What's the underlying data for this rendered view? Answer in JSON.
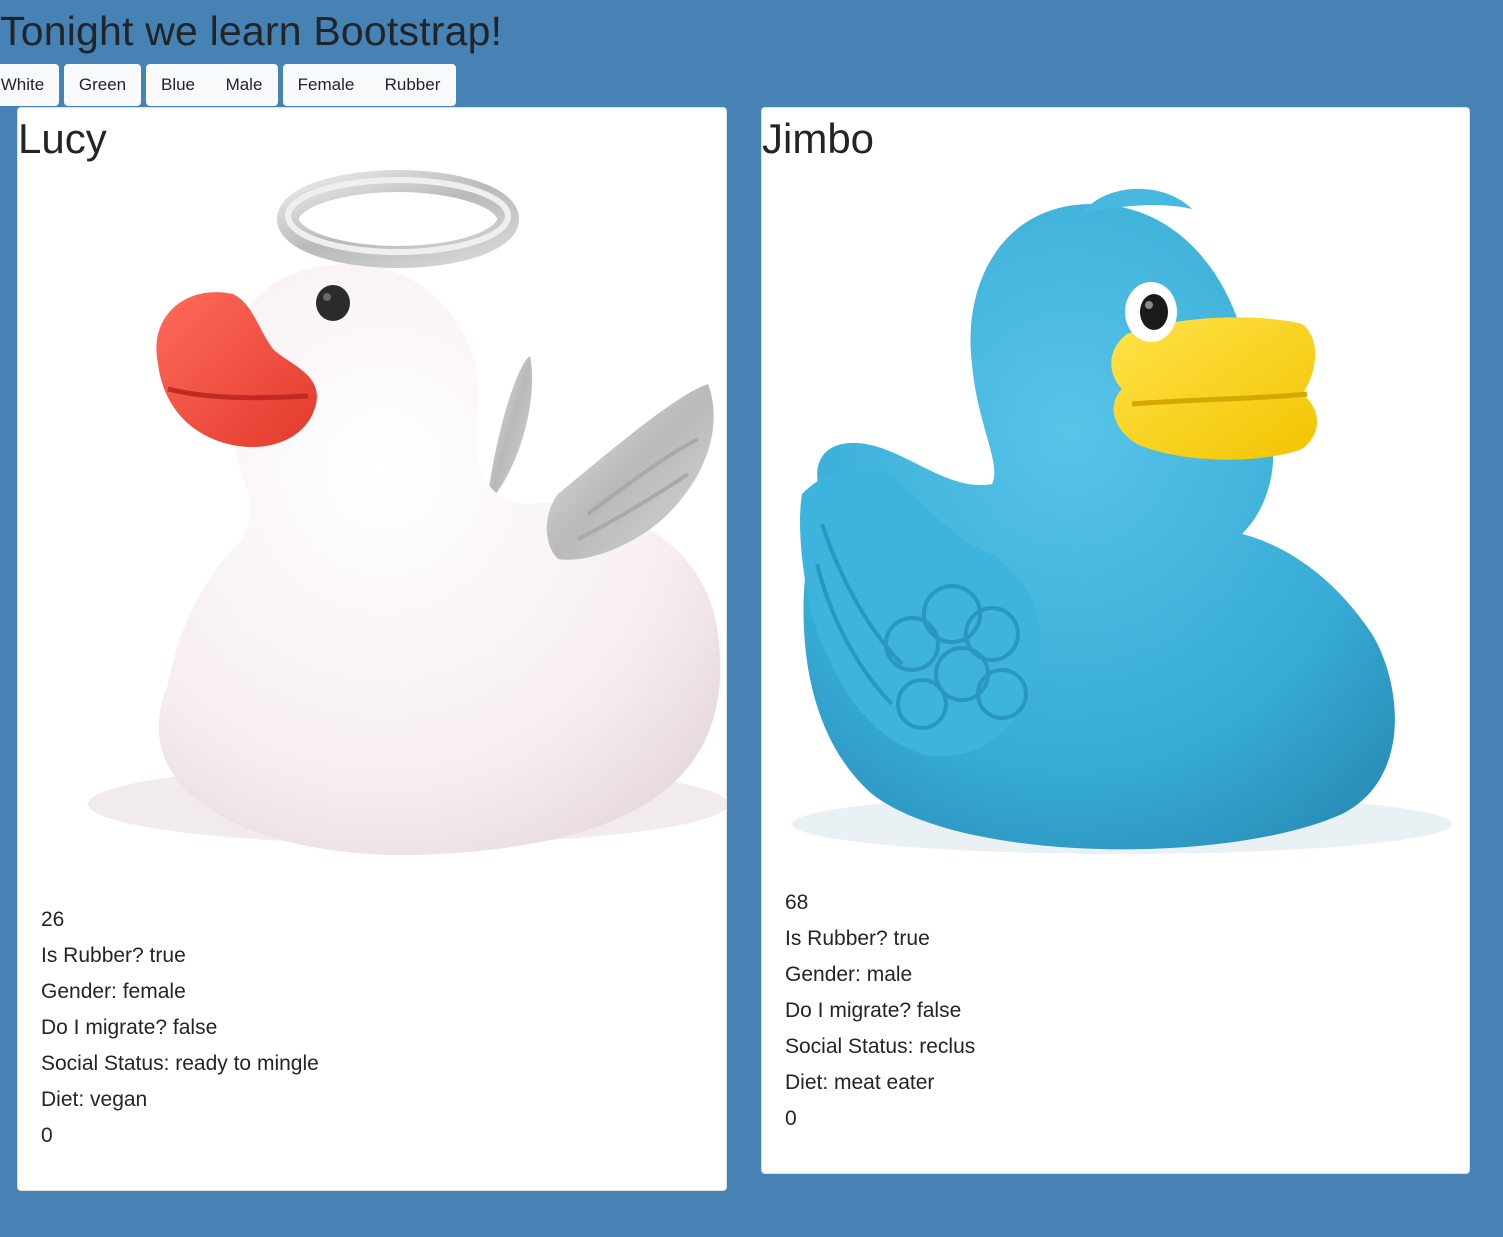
{
  "page": {
    "title": "Tonight we learn Bootstrap!"
  },
  "filters": [
    {
      "label": "White"
    },
    {
      "label": "Green"
    },
    {
      "label": "Blue"
    },
    {
      "label": "Male"
    },
    {
      "label": "Female"
    },
    {
      "label": "Rubber"
    }
  ],
  "ducks": [
    {
      "name": "Lucy",
      "image": "white-angel-rubber-duck",
      "number": "26",
      "rubber": "Is Rubber? true",
      "gender": "Gender: female",
      "migrate": "Do I migrate? false",
      "social": "Social Status: ready to mingle",
      "diet": "Diet: vegan",
      "count": "0"
    },
    {
      "name": "Jimbo",
      "image": "blue-rubber-duck",
      "number": "68",
      "rubber": "Is Rubber? true",
      "gender": "Gender: male",
      "migrate": "Do I migrate? false",
      "social": "Social Status: reclus",
      "diet": "Diet: meat eater",
      "count": "0"
    }
  ],
  "colors": {
    "background": "#4682b4",
    "card": "#ffffff",
    "button": "#f8f9fa",
    "text": "#212529"
  }
}
